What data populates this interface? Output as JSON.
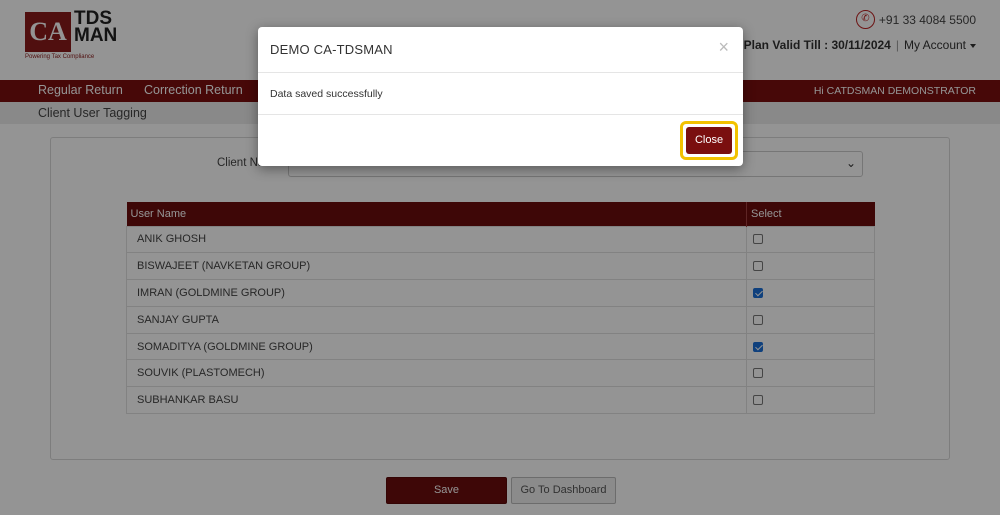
{
  "header": {
    "logo_mark": "CA",
    "logo_word1": "TDS",
    "logo_word2": "MAN",
    "logo_tagline": "Powering Tax Compliance",
    "phone": "+91 33 4084 5500",
    "plan_label": "Plan Valid Till : 30/11/2024",
    "account_label": "My Account"
  },
  "nav": {
    "items": [
      "Regular Return",
      "Correction Return"
    ],
    "greeting": "Hi CATDSMAN DEMONSTRATOR"
  },
  "subbar": {
    "title": "Client User Tagging"
  },
  "form": {
    "client_label": "Client Name",
    "client_value": ""
  },
  "table": {
    "headers": [
      "User Name",
      "Select"
    ],
    "rows": [
      {
        "name": "ANIK GHOSH",
        "checked": false
      },
      {
        "name": "BISWAJEET (NAVKETAN GROUP)",
        "checked": false
      },
      {
        "name": "IMRAN (GOLDMINE GROUP)",
        "checked": true
      },
      {
        "name": "SANJAY GUPTA",
        "checked": false
      },
      {
        "name": "SOMADITYA (GOLDMINE GROUP)",
        "checked": true
      },
      {
        "name": "SOUVIK (PLASTOMECH)",
        "checked": false
      },
      {
        "name": "SUBHANKAR BASU",
        "checked": false
      }
    ]
  },
  "buttons": {
    "save": "Save",
    "dashboard": "Go To Dashboard"
  },
  "modal": {
    "title": "DEMO CA-TDSMAN",
    "close_x": "×",
    "message": "Data saved successfully",
    "close_label": "Close"
  },
  "colors": {
    "brand": "#7a0f0f",
    "highlight": "#f2c200",
    "checkbox_on": "#1a6fd8"
  }
}
